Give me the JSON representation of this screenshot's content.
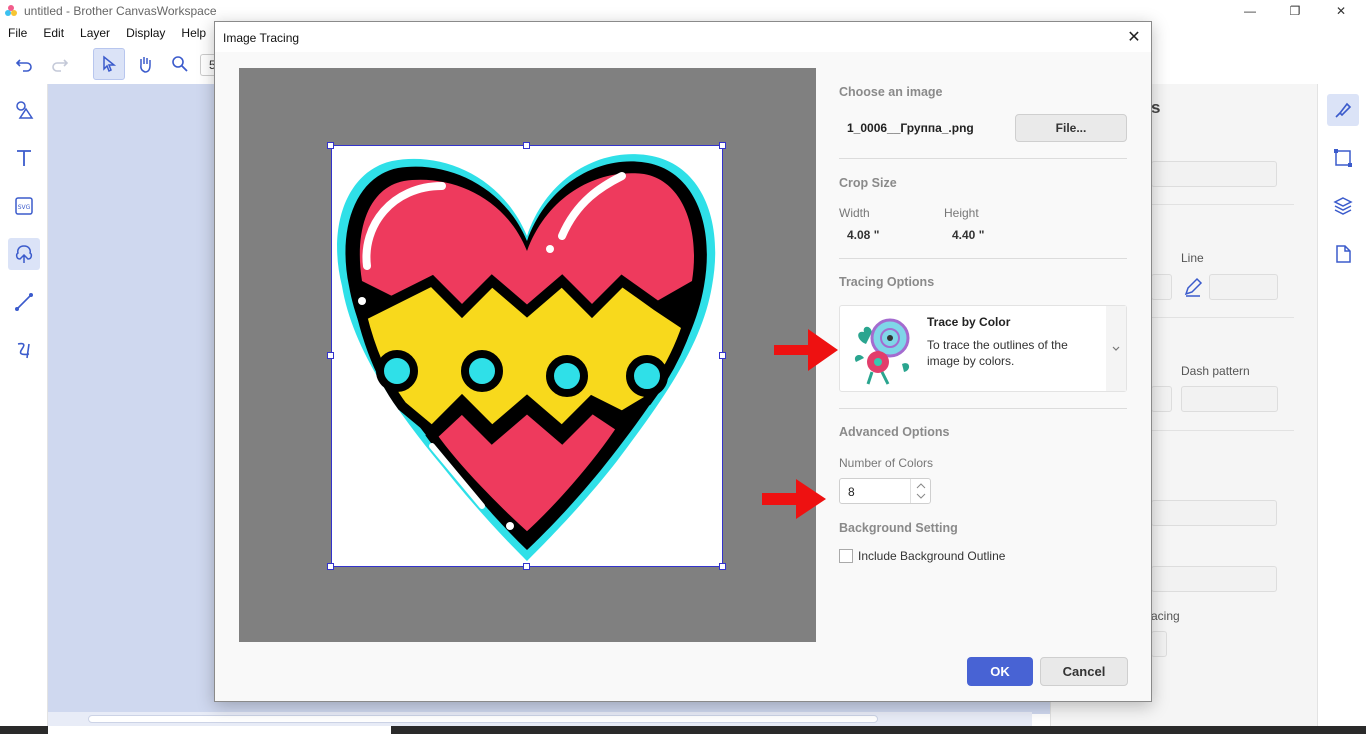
{
  "window": {
    "title": "untitled - Brother CanvasWorkspace",
    "minimize": "—",
    "restore": "❐",
    "close": "✕"
  },
  "menu": [
    "File",
    "Edit",
    "Layer",
    "Display",
    "Help"
  ],
  "toolbar": {
    "zoom_partial": "5"
  },
  "right_panel": {
    "heading_partial": "s",
    "line_label": "Line",
    "dash_label": "Dash pattern",
    "spacing_partial": "acing"
  },
  "dialog": {
    "title": "Image Tracing",
    "close": "✕",
    "choose_image": {
      "title": "Choose an image",
      "filename": "1_0006__Группа_.png",
      "file_button": "File..."
    },
    "crop_size": {
      "title": "Crop Size",
      "width_label": "Width",
      "width_value": "4.08 \"",
      "height_label": "Height",
      "height_value": "4.40 \""
    },
    "tracing_options": {
      "title": "Tracing Options",
      "mode_title": "Trace by Color",
      "mode_desc": "To trace the outlines of the image by colors."
    },
    "advanced": {
      "title": "Advanced Options",
      "colors_label": "Number of Colors",
      "colors_value": "8",
      "bg_title": "Background Setting",
      "bg_checkbox": "Include Background Outline",
      "bg_checked": false
    },
    "ok": "OK",
    "cancel": "Cancel"
  },
  "colors": {
    "accent": "#4863d4",
    "heart_red": "#ee3a5d",
    "heart_yellow": "#f8d91c",
    "outline_cyan": "#2fe0e8",
    "arrow_red": "#ee1111"
  }
}
